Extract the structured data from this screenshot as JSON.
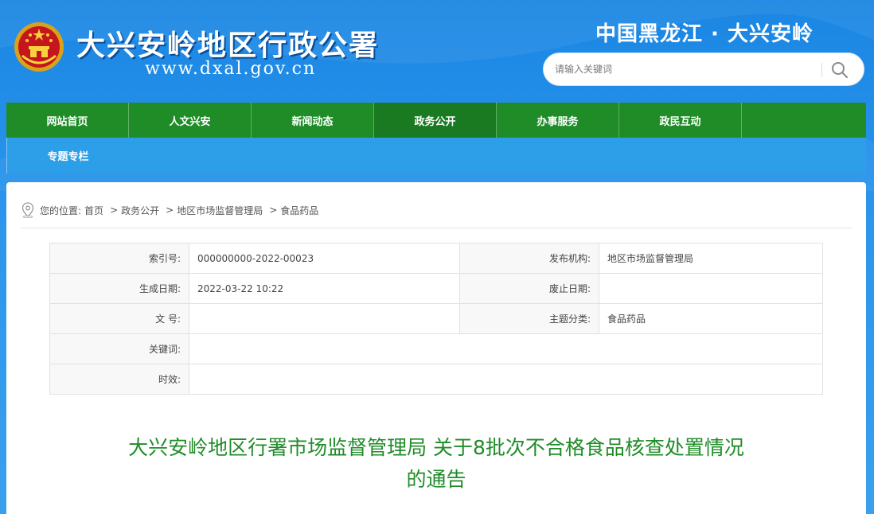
{
  "header": {
    "site_title": "大兴安岭地区行政公署",
    "site_url": "www.dxal.gov.cn",
    "region_title": "中国黑龙江 · 大兴安岭",
    "search_placeholder": "请输入关键词",
    "emblem_icon": "national-emblem-icon",
    "search_icon": "search-icon"
  },
  "nav": {
    "items": [
      {
        "label": "网站首页"
      },
      {
        "label": "人文兴安"
      },
      {
        "label": "新闻动态"
      },
      {
        "label": "政务公开",
        "active": true
      },
      {
        "label": "办事服务"
      },
      {
        "label": "政民互动"
      }
    ],
    "row2": [
      {
        "label": "专题专栏"
      }
    ]
  },
  "breadcrumb": {
    "prefix": "您的位置:",
    "items": [
      "首页",
      "政务公开",
      "地区市场监督管理局",
      "食品药品"
    ],
    "separator": ">",
    "icon": "location-pin-icon"
  },
  "meta": {
    "index_label": "索引号:",
    "index_value": "000000000-2022-00023",
    "publisher_label": "发布机构:",
    "publisher_value": "地区市场监督管理局",
    "date_label": "生成日期:",
    "date_value": "2022-03-22 10:22",
    "abolish_label": "废止日期:",
    "abolish_value": "",
    "docno_label": "文 号:",
    "docno_value": "",
    "topic_label": "主题分类:",
    "topic_value": "食品药品",
    "keywords_label": "关键词:",
    "keywords_value": "",
    "validity_label": "时效:",
    "validity_value": ""
  },
  "article": {
    "title_line1": "大兴安岭地区行署市场监督管理局 关于8批次不合格食品核查处置情况",
    "title_line2": "的通告"
  },
  "colors": {
    "nav_green": "#1f8c28",
    "title_green": "#1f8c28",
    "header_blue": "#1a86e3"
  }
}
